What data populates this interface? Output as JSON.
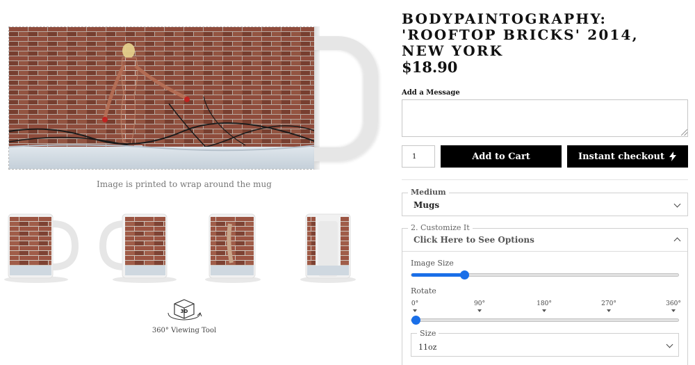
{
  "product": {
    "title": "BODYPAINTOGRAPHY: 'ROOFTOP BRICKS' 2014, NEW YORK",
    "price": "$18.90"
  },
  "preview": {
    "wrap_caption": "Image is printed to wrap around the mug",
    "viewer_label": "360° Viewing Tool",
    "viewer_badge": "3D",
    "thumbnails": [
      "mug-right-view",
      "mug-left-view",
      "mug-front-view",
      "mug-side-view"
    ]
  },
  "message": {
    "label": "Add a Message",
    "value": ""
  },
  "purchase": {
    "quantity": "1",
    "add_to_cart": "Add to Cart",
    "instant_checkout": "Instant checkout",
    "checkout_icon": "lightning-bolt-icon"
  },
  "medium": {
    "legend": "Medium",
    "value": "Mugs"
  },
  "customize": {
    "legend": "2. Customize It",
    "toggle_label": "Click Here to See Options",
    "image_size": {
      "label": "Image Size",
      "value_fraction": 0.2
    },
    "rotate": {
      "label": "Rotate",
      "ticks": [
        "0°",
        "90°",
        "180°",
        "270°",
        "360°"
      ],
      "value": "0°"
    },
    "size": {
      "legend": "Size",
      "value": "11oz"
    }
  },
  "colors": {
    "accent": "#1a6fe8",
    "button_bg": "#000000",
    "button_text": "#ffffff"
  }
}
